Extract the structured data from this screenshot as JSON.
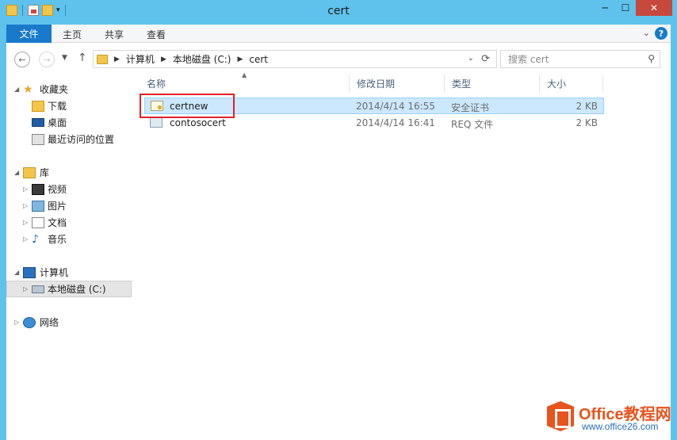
{
  "window": {
    "title": "cert",
    "minimize_glyph": "─",
    "maximize_glyph": "☐",
    "close_glyph": "✕"
  },
  "ribbon": {
    "tabs": [
      "文件",
      "主页",
      "共享",
      "查看"
    ],
    "help_glyph": "?",
    "collapse_glyph": "⌄"
  },
  "address": {
    "crumbs": [
      "计算机",
      "本地磁盘 (C:)",
      "cert"
    ],
    "search_placeholder": "搜索 cert"
  },
  "navigation": {
    "favorites": {
      "label": "收藏夹",
      "items": [
        "下载",
        "桌面",
        "最近访问的位置"
      ]
    },
    "libraries": {
      "label": "库",
      "items": [
        "视频",
        "图片",
        "文档",
        "音乐"
      ]
    },
    "computer": {
      "label": "计算机",
      "items": [
        "本地磁盘 (C:)"
      ]
    },
    "network": {
      "label": "网络"
    }
  },
  "files": {
    "columns": [
      "名称",
      "修改日期",
      "类型",
      "大小"
    ],
    "rows": [
      {
        "name": "certnew",
        "date": "2014/4/14 16:55",
        "type": "安全证书",
        "size": "2 KB",
        "icon": "certificate-icon"
      },
      {
        "name": "contosocert",
        "date": "2014/4/14 16:41",
        "type": "REQ 文件",
        "size": "2 KB",
        "icon": "req-file-icon"
      }
    ]
  },
  "watermark": {
    "brand": "Office教程网",
    "url": "www.office26.com",
    "brand_color": "#e8541d",
    "url_color": "#2a6fbd"
  },
  "colors": {
    "titlebar": "#5fc2ec",
    "file_tab": "#1979ca",
    "selection": "#cce8ff",
    "highlight_box": "#e0222a"
  }
}
